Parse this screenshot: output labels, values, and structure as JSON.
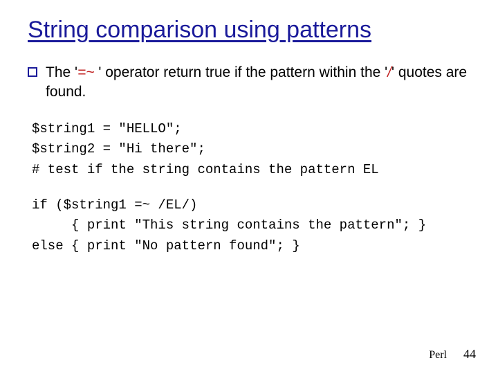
{
  "title": "String comparison using patterns",
  "bullet": {
    "pre": "The '",
    "op": "=~",
    "mid": " ' operator return true if the pattern within the '",
    "slash": "/",
    "post": "' quotes are found."
  },
  "code1": "$string1 = \"HELLO\";\n$string2 = \"Hi there\";\n# test if the string contains the pattern EL",
  "code2": "if ($string1 =~ /EL/)\n     { print \"This string contains the pattern\"; }\nelse { print \"No pattern found\"; }",
  "footer": {
    "label": "Perl",
    "page": "44"
  }
}
